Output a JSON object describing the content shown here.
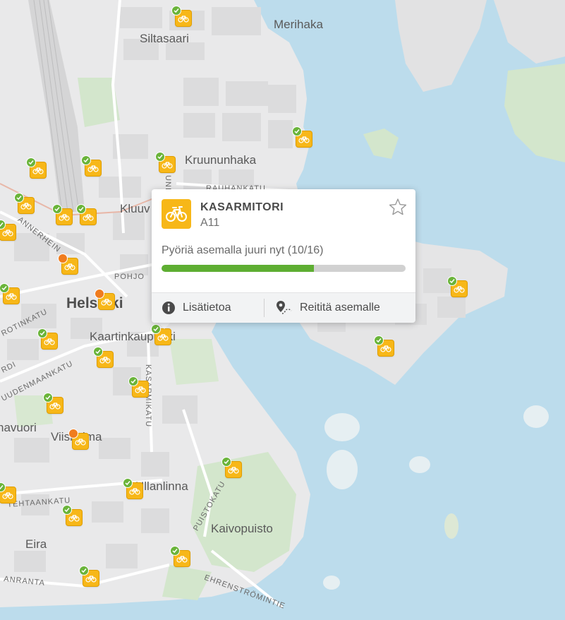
{
  "map": {
    "districts": [
      "Merihaka",
      "Siltasaari",
      "Kruununhaka",
      "Kluuv",
      "Kaartinkaupunki",
      "Viiskulma",
      "Ullanlinna",
      "Kaivopuisto",
      "Eira",
      "navuori"
    ],
    "city": "Helsinki",
    "streets": [
      "Pohjo",
      "Unio",
      "Rauhankatu",
      "Annerhein",
      "Rotinkatu",
      "Uudenmaankatu",
      "Kasarmikatu",
      "Tehtaankatu",
      "Puistokatu",
      "Ehrenströmintie",
      "Anranta",
      "Rdi"
    ]
  },
  "popup": {
    "station_name": "KASARMITORI",
    "station_code": "A11",
    "availability_text": "Pyöriä asemalla juuri nyt (10/16)",
    "bikes_available": 10,
    "capacity": 16,
    "info_label": "Lisätietoa",
    "route_label": "Reititä asemalle",
    "icons": {
      "station": "bicycle-icon",
      "favorite": "star-outline-icon",
      "info": "info-circle-icon",
      "route": "route-pin-icon"
    }
  },
  "colors": {
    "water": "#bcdcec",
    "land": "#ececec",
    "park": "#d3e6cc",
    "station": "#f7b718",
    "bar_fill": "#5eae32",
    "bar_bg": "#d1d1d1",
    "badge_ok": "#6ab43a",
    "badge_low": "#f07c1e"
  }
}
